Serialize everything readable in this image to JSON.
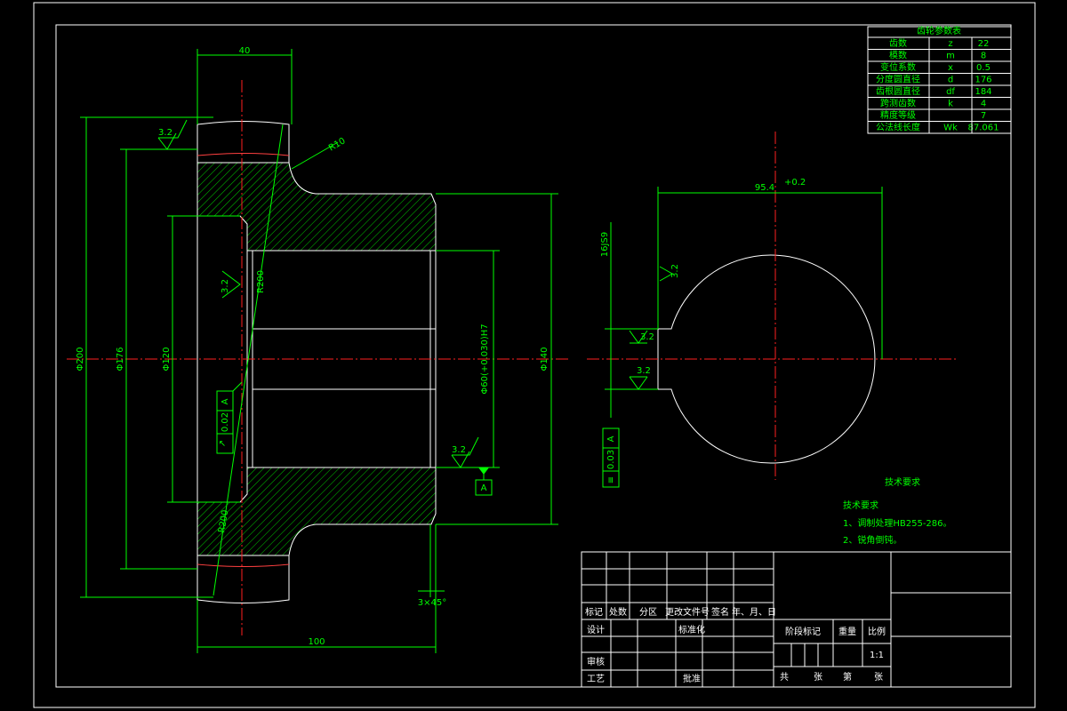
{
  "drawing": {
    "param_table": {
      "header": "齿轮参数表",
      "rows": [
        {
          "name": "齿数",
          "sym": "z",
          "val": "22"
        },
        {
          "name": "模数",
          "sym": "m",
          "val": "8"
        },
        {
          "name": "变位系数",
          "sym": "x",
          "val": "0.5"
        },
        {
          "name": "分度圆直径",
          "sym": "d",
          "val": "176"
        },
        {
          "name": "齿根圆直径",
          "sym": "df",
          "val": "184"
        },
        {
          "name": "跨测齿数",
          "sym": "k",
          "val": "4"
        },
        {
          "name": "精度等级",
          "sym": "",
          "val": "7"
        },
        {
          "name": "公法线长度",
          "sym": "Wk",
          "val": "87.061"
        }
      ]
    },
    "dims": {
      "top_width": "40",
      "bottom_width": "100",
      "radius_fillet": "R10",
      "radius_b": "R200",
      "dia_200": "Φ200",
      "dia_176": "Φ176",
      "dia_120": "Φ120",
      "dia_140": "Φ140",
      "bore": "Φ60(+0.030)H7",
      "chamfer": "3×45°",
      "key_width": "95.4",
      "key_tol": "+0.2",
      "keyway": "16JS9",
      "roughness": "3.2",
      "datum": "A",
      "runout": "0.02",
      "runout_datum": "A",
      "sym_tol": "0.03",
      "rotated_label": "R200"
    },
    "tech": {
      "title": "技术要求",
      "subtitle": "技术要求",
      "line1": "1、调制处理HB255-286。",
      "line2": "2、锐角倒钝。"
    },
    "title_block": {
      "row_labels": [
        "标记",
        "处数",
        "分区",
        "更改文件号",
        "签名",
        "年、月、日"
      ],
      "design": "设计",
      "standard": "标准化",
      "review": "审核",
      "process": "工艺",
      "approve": "批准",
      "stage": "阶段标记",
      "weight": "重量",
      "scale_label": "比例",
      "scale": "1:1",
      "sheets_total": "共",
      "sheet_unit1": "张",
      "sheet_no": "第",
      "sheet_unit2": "张"
    }
  }
}
